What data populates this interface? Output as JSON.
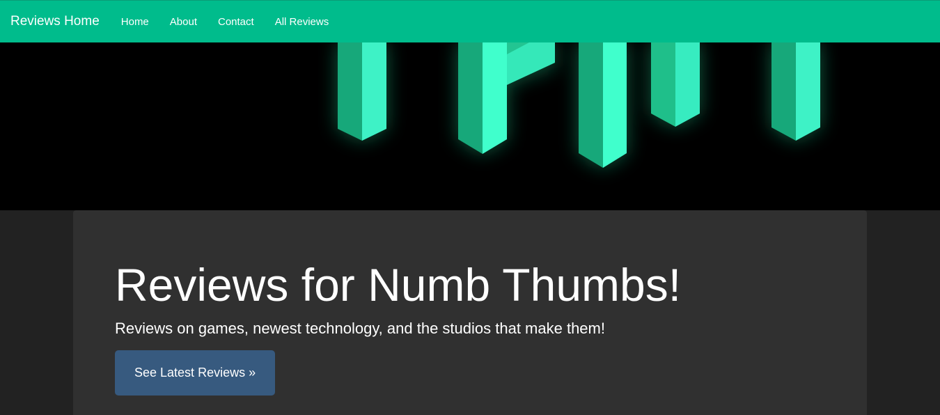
{
  "navbar": {
    "brand": "Reviews Home",
    "links": [
      "Home",
      "About",
      "Contact",
      "All Reviews"
    ],
    "background_color": "#00bc8c"
  },
  "hero": {
    "background_color": "#000000",
    "accent_color": "#3effc8",
    "image": "glowing-green-3d-letters"
  },
  "jumbotron": {
    "title": "Reviews for Numb Thumbs!",
    "lead": "Reviews on games, newest technology, and the studios that make them!",
    "button_label": "See Latest Reviews »",
    "button_color": "#375a7f"
  }
}
